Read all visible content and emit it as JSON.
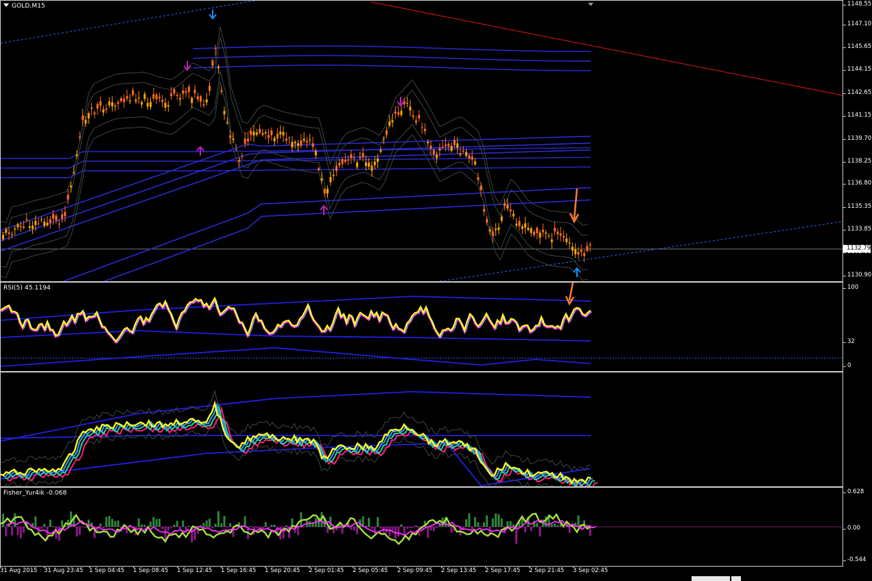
{
  "chart": {
    "symbol_label": "GOLD,M15",
    "current_price": "1132.79",
    "price_ticks": [
      "1148.55",
      "1147.10",
      "1145.65",
      "1144.15",
      "1142.65",
      "1141.15",
      "1139.70",
      "1138.25",
      "1136.80",
      "1135.35",
      "1133.85",
      "1132.35",
      "1130.90"
    ],
    "colors": {
      "background": "#000000",
      "bull_candle": "#ffa500",
      "bear_candle": "#ff6e1e",
      "envelope": "#2a2ad0",
      "bands": "#2e3a36",
      "trend_line": "#e01818",
      "channel_line": "#3a66ff",
      "arrow_signal": "#1e90ff",
      "arrow_annotation": "#ff7f2a"
    },
    "icons": [
      "dropdown-triangle-icon",
      "down-signal-arrow-icon",
      "up-signal-arrow-icon",
      "fractal-arrow-icon",
      "annotation-arrow-icon"
    ]
  },
  "rsi": {
    "label": "RSI(5) 45.1194",
    "ticks": [
      "100",
      "32",
      "0"
    ],
    "value": 45.1194
  },
  "fisher": {
    "label": "Fisher_Yur4ik -0.068",
    "ticks": [
      "0.628",
      "0.00",
      "-0.544"
    ],
    "value": -0.068
  },
  "time_axis": {
    "labels": [
      "31 Aug 2015",
      "31 Aug 23:45",
      "1 Sep 04:45",
      "1 Sep 08:45",
      "1 Sep 12:45",
      "1 Sep 16:45",
      "1 Sep 20:45",
      "2 Sep 01:45",
      "2 Sep 05:45",
      "2 Sep 09:45",
      "2 Sep 13:45",
      "2 Sep 17:45",
      "2 Sep 21:45",
      "3 Sep 02:45"
    ]
  }
}
